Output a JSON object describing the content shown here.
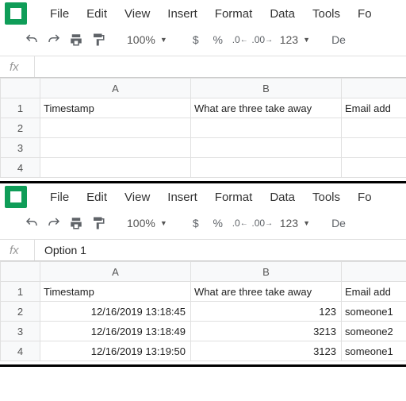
{
  "menubar": [
    "File",
    "Edit",
    "View",
    "Insert",
    "Format",
    "Data",
    "Tools",
    "Fo"
  ],
  "toolbar": {
    "zoom": "100%",
    "dollar": "$",
    "percent": "%",
    "dec_less": ".0",
    "dec_more": ".00",
    "numfmt": "123",
    "font_cut": "De"
  },
  "top": {
    "fx": "",
    "columns": [
      "",
      "A",
      "B",
      ""
    ],
    "rows": [
      {
        "n": "1",
        "a": "Timestamp",
        "b": "What are three take away",
        "c": "Email add"
      },
      {
        "n": "2",
        "a": "",
        "b": "",
        "c": ""
      },
      {
        "n": "3",
        "a": "",
        "b": "",
        "c": ""
      },
      {
        "n": "4",
        "a": "",
        "b": "",
        "c": ""
      }
    ]
  },
  "bottom": {
    "fx": "Option 1",
    "columns": [
      "",
      "A",
      "B",
      ""
    ],
    "rows": [
      {
        "n": "1",
        "a": "Timestamp",
        "b": "What are three take away",
        "c": "Email add",
        "anum": false,
        "bnum": false
      },
      {
        "n": "2",
        "a": "12/16/2019 13:18:45",
        "b": "123",
        "c": "someone1",
        "anum": true,
        "bnum": true
      },
      {
        "n": "3",
        "a": "12/16/2019 13:18:49",
        "b": "3213",
        "c": "someone2",
        "anum": true,
        "bnum": true
      },
      {
        "n": "4",
        "a": "12/16/2019 13:19:50",
        "b": "3123",
        "c": "someone1",
        "anum": true,
        "bnum": true
      }
    ]
  }
}
